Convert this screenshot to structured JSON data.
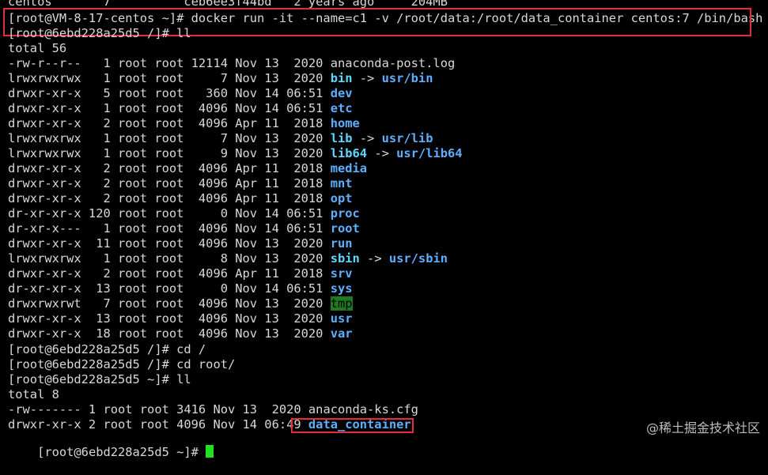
{
  "top_partial": "centos       7          ceb6ee3f44bd   2 years ago     204MB",
  "command": "[root@VM-8-17-centos ~]# docker run -it --name=c1 -v /root/data:/root/data_container centos:7 /bin/bash",
  "prompt1": "[root@6ebd228a25d5 /]# ll",
  "total1": "total 56",
  "listing": [
    {
      "perm": "-rw-r--r--   1 root root 12114 Nov 13  2020 ",
      "name": "anaconda-post.log",
      "type": "file"
    },
    {
      "perm": "lrwxrwxrwx   1 root root     7 Nov 13  2020 ",
      "name": "bin",
      "arrow": " -> ",
      "target": "usr/bin",
      "type": "link"
    },
    {
      "perm": "drwxr-xr-x   5 root root   360 Nov 14 06:51 ",
      "name": "dev",
      "type": "dir"
    },
    {
      "perm": "drwxr-xr-x   1 root root  4096 Nov 14 06:51 ",
      "name": "etc",
      "type": "dir"
    },
    {
      "perm": "drwxr-xr-x   2 root root  4096 Apr 11  2018 ",
      "name": "home",
      "type": "dir"
    },
    {
      "perm": "lrwxrwxrwx   1 root root     7 Nov 13  2020 ",
      "name": "lib",
      "arrow": " -> ",
      "target": "usr/lib",
      "type": "link"
    },
    {
      "perm": "lrwxrwxrwx   1 root root     9 Nov 13  2020 ",
      "name": "lib64",
      "arrow": " -> ",
      "target": "usr/lib64",
      "type": "link"
    },
    {
      "perm": "drwxr-xr-x   2 root root  4096 Apr 11  2018 ",
      "name": "media",
      "type": "dir"
    },
    {
      "perm": "drwxr-xr-x   2 root root  4096 Apr 11  2018 ",
      "name": "mnt",
      "type": "dir"
    },
    {
      "perm": "drwxr-xr-x   2 root root  4096 Apr 11  2018 ",
      "name": "opt",
      "type": "dir"
    },
    {
      "perm": "dr-xr-xr-x 120 root root     0 Nov 14 06:51 ",
      "name": "proc",
      "type": "dir"
    },
    {
      "perm": "dr-xr-x---   1 root root  4096 Nov 14 06:51 ",
      "name": "root",
      "type": "dir"
    },
    {
      "perm": "drwxr-xr-x  11 root root  4096 Nov 13  2020 ",
      "name": "run",
      "type": "dir"
    },
    {
      "perm": "lrwxrwxrwx   1 root root     8 Nov 13  2020 ",
      "name": "sbin",
      "arrow": " -> ",
      "target": "usr/sbin",
      "type": "link"
    },
    {
      "perm": "drwxr-xr-x   2 root root  4096 Apr 11  2018 ",
      "name": "srv",
      "type": "dir"
    },
    {
      "perm": "dr-xr-xr-x  13 root root     0 Nov 14 06:51 ",
      "name": "sys",
      "type": "dir"
    },
    {
      "perm": "drwxrwxrwt   7 root root  4096 Nov 13  2020 ",
      "name": "tmp",
      "type": "tmp"
    },
    {
      "perm": "drwxr-xr-x  13 root root  4096 Nov 13  2020 ",
      "name": "usr",
      "type": "dir"
    },
    {
      "perm": "drwxr-xr-x  18 root root  4096 Nov 13  2020 ",
      "name": "var",
      "type": "dir"
    }
  ],
  "cmd_cd1": "[root@6ebd228a25d5 /]# cd /",
  "cmd_cd2": "[root@6ebd228a25d5 /]# cd root/",
  "cmd_ll2": "[root@6ebd228a25d5 ~]# ll",
  "total2": "total 8",
  "listing2": [
    {
      "perm": "-rw------- 1 root root 3416 Nov 13  2020 ",
      "name": "anaconda-ks.cfg",
      "type": "file"
    },
    {
      "perm": "drwxr-xr-x 2 root root 4096 Nov 14 06:49 ",
      "name": "data_container",
      "type": "dir"
    }
  ],
  "final_prompt": "[root@6ebd228a25d5 ~]# ",
  "watermark": "@稀土掘金技术社区",
  "colors": {
    "background": "#000000",
    "text": "#d8d8d8",
    "dir": "#5fafff",
    "highlight_box": "#e32d3a",
    "cursor": "#22e022",
    "tmp_bg": "#1f7a1f"
  }
}
